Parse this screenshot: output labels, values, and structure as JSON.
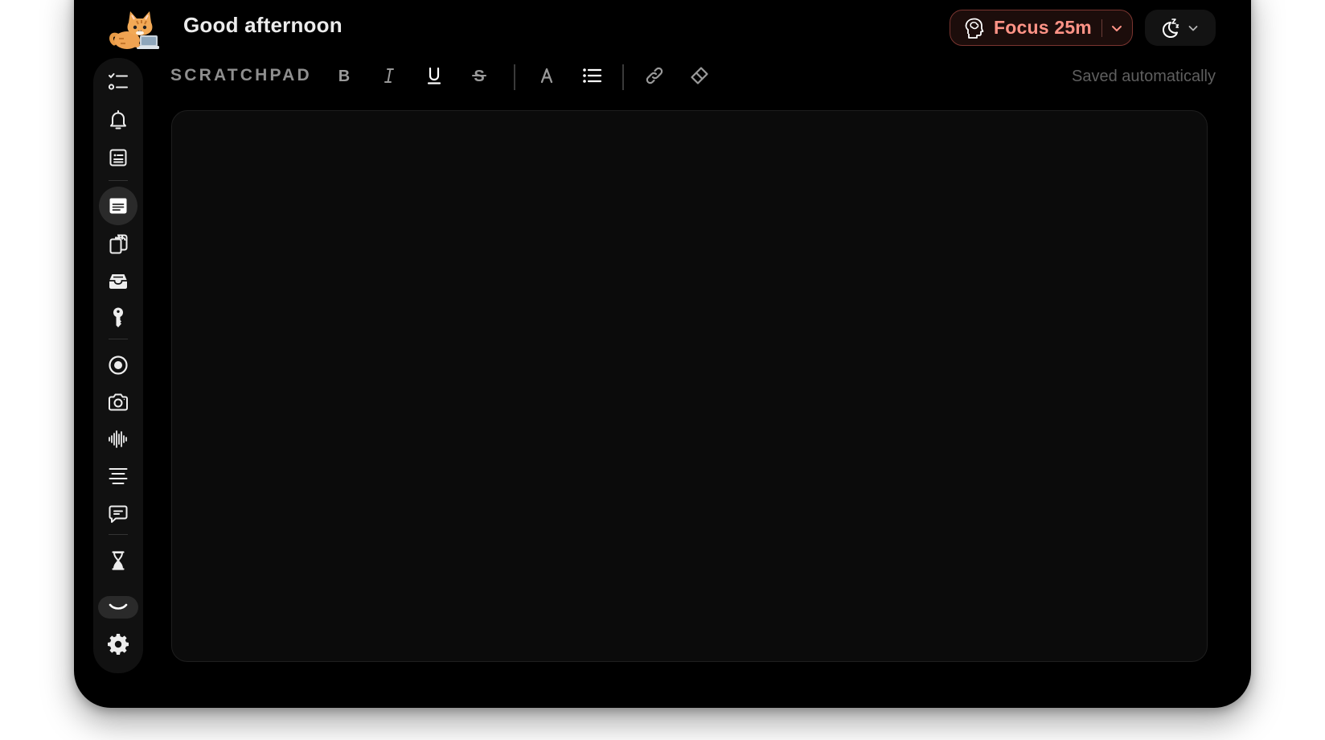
{
  "header": {
    "greeting": "Good afternoon",
    "focus_label": "Focus 25m"
  },
  "sidebar": {
    "items": [
      {
        "icon": "checklist-icon",
        "active": false
      },
      {
        "icon": "bell-icon",
        "active": false
      },
      {
        "icon": "clipboard-list-icon",
        "active": false
      },
      {
        "icon": "scratchpad-icon",
        "active": true
      },
      {
        "icon": "copy-documents-icon",
        "active": false
      },
      {
        "icon": "inbox-tray-icon",
        "active": false
      },
      {
        "icon": "key-icon",
        "active": false
      },
      {
        "icon": "record-icon",
        "active": false
      },
      {
        "icon": "camera-icon",
        "active": false
      },
      {
        "icon": "audio-waveform-icon",
        "active": false
      },
      {
        "icon": "text-align-center-icon",
        "active": false
      },
      {
        "icon": "chat-bubble-icon",
        "active": false
      },
      {
        "icon": "hourglass-icon",
        "active": false
      },
      {
        "icon": "chevron-down-icon",
        "active": false
      },
      {
        "icon": "gear-icon",
        "active": false
      }
    ]
  },
  "scratchpad": {
    "title": "SCRATCHPAD",
    "status": "Saved automatically",
    "content": ""
  },
  "toolbar": {
    "tools": [
      "bold",
      "italic",
      "underline",
      "strikethrough",
      "font-color",
      "bullet-list",
      "link",
      "clear-formatting"
    ]
  },
  "colors": {
    "background": "#000000",
    "panel": "#111111",
    "focus_accent": "#ff9386",
    "focus_border": "#7a3530"
  }
}
